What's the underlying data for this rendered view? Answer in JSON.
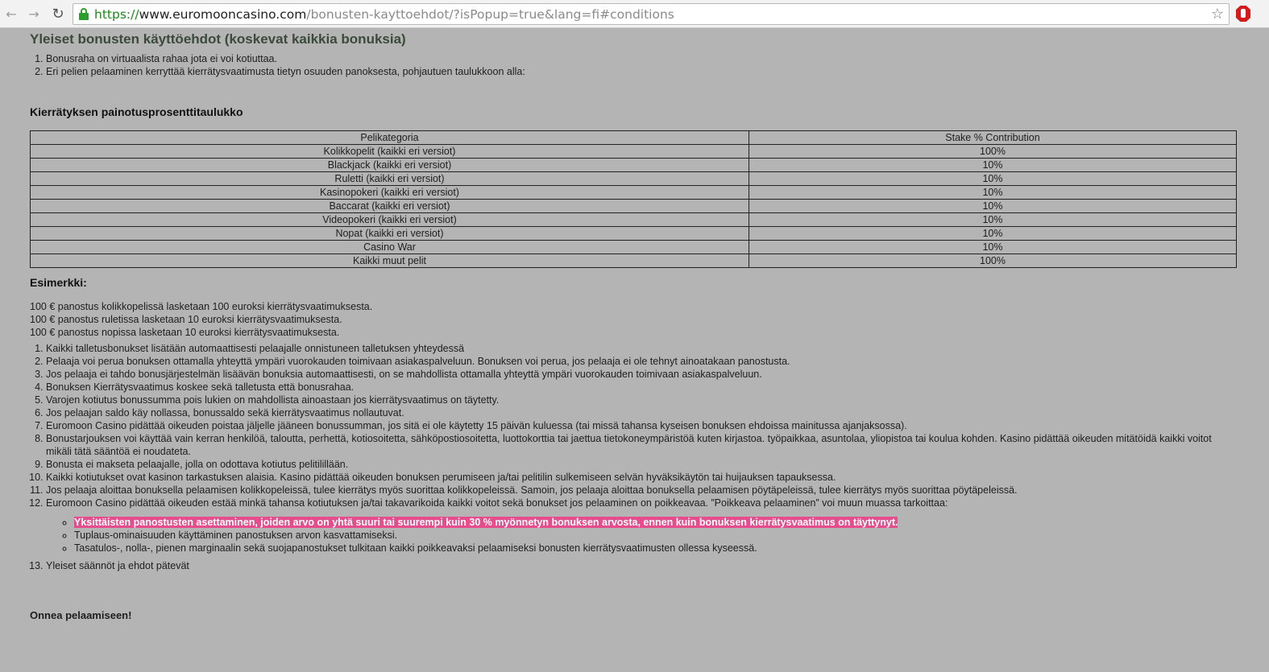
{
  "browser": {
    "url_scheme": "https://",
    "url_host": "www.euromooncasino.com",
    "url_path": "/bonusten-kayttoehdot/?isPopup=true&lang=fi#conditions",
    "icons": [
      "back-arrow-icon",
      "forward-arrow-icon",
      "reload-icon",
      "lock-icon",
      "star-icon",
      "adblock-icon"
    ]
  },
  "page": {
    "title": "Yleiset bonusten käyttöehdot (koskevat kaikkia bonuksia)",
    "intro_items": [
      "Bonusraha on virtuaalista rahaa jota ei voi kotiuttaa.",
      "Eri pelien pelaaminen kerryttää kierrätysvaatimusta tietyn osuuden panoksesta, pohjautuen taulukkoon alla:"
    ],
    "table_title": "Kierrätyksen painotusprosenttitaulukko",
    "table": {
      "headers": [
        "Pelikategoria",
        "Stake % Contribution"
      ],
      "rows": [
        [
          "Kolikkopelit (kaikki eri versiot)",
          "100%"
        ],
        [
          "Blackjack (kaikki eri versiot)",
          "10%"
        ],
        [
          "Ruletti (kaikki eri versiot)",
          "10%"
        ],
        [
          "Kasinopokeri (kaikki eri versiot)",
          "10%"
        ],
        [
          "Baccarat (kaikki eri versiot)",
          "10%"
        ],
        [
          "Videopokeri (kaikki eri versiot)",
          "10%"
        ],
        [
          "Nopat (kaikki eri versiot)",
          "10%"
        ],
        [
          "Casino War",
          "10%"
        ],
        [
          "Kaikki muut pelit",
          "100%"
        ]
      ]
    },
    "example_title": "Esimerkki:",
    "example_lines": [
      "100 € panostus kolikkopelissä lasketaan 100 euroksi kierrätysvaatimuksesta.",
      "100 € panostus ruletissa lasketaan 10 euroksi kierrätysvaatimuksesta.",
      "100 € panostus nopissa lasketaan 10 euroksi kierrätysvaatimuksesta."
    ],
    "terms": [
      "Kaikki talletusbonukset lisätään automaattisesti pelaajalle onnistuneen talletuksen yhteydessä",
      "Pelaaja voi perua bonuksen ottamalla yhteyttä ympäri vuorokauden toimivaan asiakaspalveluun. Bonuksen voi perua, jos pelaaja ei ole tehnyt ainoatakaan panostusta.",
      "Jos pelaaja ei tahdo bonusjärjestelmän lisäävän bonuksia automaattisesti, on se mahdollista ottamalla yhteyttä ympäri vuorokauden toimivaan asiakaspalveluun.",
      "Bonuksen Kierrätysvaatimus koskee sekä talletusta että bonusrahaa.",
      "Varojen kotiutus bonussumma pois lukien on mahdollista ainoastaan jos kierrätysvaatimus on täytetty.",
      "Jos pelaajan saldo käy nollassa, bonussaldo sekä kierrätysvaatimus nollautuvat.",
      "Euromoon Casino pidättää oikeuden poistaa jäljelle jääneen bonussumman, jos sitä ei ole käytetty 15 päivän kuluessa (tai missä tahansa kyseisen bonuksen ehdoissa mainitussa ajanjaksossa).",
      "Bonustarjouksen voi käyttää vain kerran henkilöä, taloutta, perhettä, kotiosoitetta, sähköpostiosoitetta, luottokorttia tai jaettua tietokoneympäristöä kuten kirjastoa. työpaikkaa, asuntolaa, yliopistoa tai koulua kohden. Kasino pidättää oikeuden mitätöidä kaikki voitot mikäli tätä sääntöä ei noudateta.",
      "Bonusta ei makseta pelaajalle, jolla on odottava kotiutus pelitilillään.",
      "Kaikki kotiutukset ovat kasinon tarkastuksen alaisia. Kasino pidättää oikeuden bonuksen perumiseen ja/tai pelitilin sulkemiseen selvän hyväksikäytön tai huijauksen tapauksessa.",
      "Jos pelaaja aloittaa bonuksella pelaamisen kolikkopeleissä, tulee kierrätys myös suorittaa kolikkopeleissä. Samoin, jos pelaaja aloittaa bonuksella pelaamisen pöytäpeleissä, tulee kierrätys myös suorittaa pöytäpeleissä.",
      "Euromoon Casino pidättää oikeuden estää minkä tahansa kotiutuksen ja/tai takavarikoida kaikki voitot sekä bonukset jos pelaaminen on poikkeavaa. ”Poikkeava pelaaminen” voi muun muassa tarkoittaa:"
    ],
    "sub_items": [
      "Yksittäisten panostusten asettaminen, joiden arvo on yhtä suuri tai suurempi kuin 30 % myönnetyn bonuksen arvosta, ennen kuin bonuksen kierrätysvaatimus on täyttynyt.",
      "Tuplaus-ominaisuuden käyttäminen panostuksen arvon kasvattamiseksi.",
      "Tasatulos-, nolla-, pienen marginaalin sekä suojapanostukset tulkitaan kaikki poikkeavaksi pelaamiseksi bonusten kierrätysvaatimusten ollessa kyseessä."
    ],
    "last_term": "Yleiset säännöt ja ehdot pätevät",
    "closing": "Onnea pelaamiseen!",
    "highlight_color": "#e64d8c"
  }
}
